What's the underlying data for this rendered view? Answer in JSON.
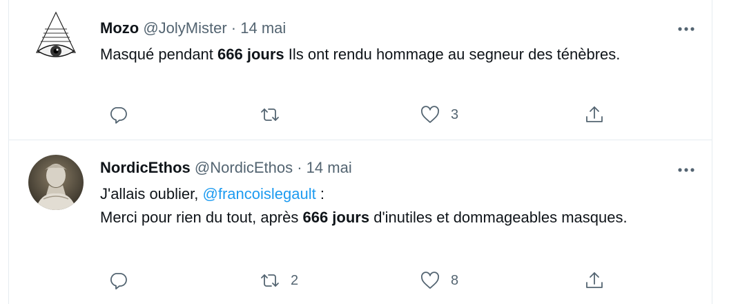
{
  "tweets": [
    {
      "name": "Mozo",
      "handle": "@JolyMister",
      "separator": "·",
      "date": "14 mai",
      "avatar_icon": "all-seeing-eye-avatar",
      "body": {
        "t1": "Masqué pendant ",
        "b1": "666 jours",
        "t2": " Ils ont rendu hommage au segneur des ténèbres."
      },
      "counts": {
        "reply": "",
        "retweet": "",
        "like": "3"
      }
    },
    {
      "name": "NordicEthos",
      "handle": "@NordicEthos",
      "separator": "·",
      "date": "14 mai",
      "avatar_icon": "statue-portrait-avatar",
      "body": {
        "line1_pre": "J'allais oublier, ",
        "mention": "@francoislegault",
        "line1_post": " :",
        "t1": "Merci pour rien du tout, après ",
        "b1": "666 jours",
        "t2": " d'inutiles et dommageables masques."
      },
      "counts": {
        "reply": "",
        "retweet": "2",
        "like": "8"
      }
    }
  ],
  "colors": {
    "text": "#0f1419",
    "secondary": "#536471",
    "link": "#1d9bf0",
    "border": "#e6ecf0"
  }
}
